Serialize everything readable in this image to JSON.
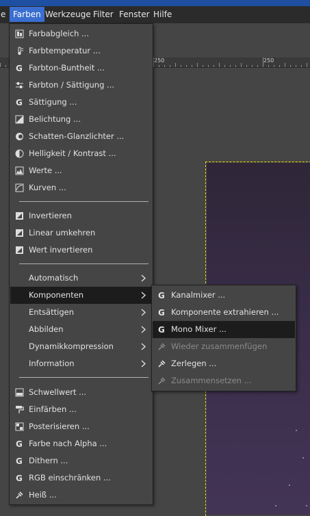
{
  "menubar": {
    "cut_item": "e",
    "items": [
      "Farben",
      "Werkzeuge",
      "Filter",
      "Fenster",
      "Hilfe"
    ]
  },
  "ruler": {
    "labels": [
      "250",
      "250"
    ]
  },
  "farben_menu": {
    "group1": [
      {
        "label": "Farbabgleich ...",
        "icon": "balance-icon"
      },
      {
        "label": "Farbtemperatur ...",
        "icon": "thermometer-icon"
      },
      {
        "label": "Farbton-Buntheit ...",
        "icon": "gegl-icon"
      },
      {
        "label": "Farbton / Sättigung ...",
        "icon": "hue-saturation-icon"
      },
      {
        "label": "Sättigung ...",
        "icon": "gegl-icon"
      },
      {
        "label": "Belichtung ...",
        "icon": "exposure-icon"
      },
      {
        "label": "Schatten-Glanzlichter ...",
        "icon": "shadows-highlights-icon"
      },
      {
        "label": "Helligkeit / Kontrast ...",
        "icon": "contrast-icon"
      },
      {
        "label": "Werte ...",
        "icon": "levels-icon"
      },
      {
        "label": "Kurven ...",
        "icon": "curves-icon"
      }
    ],
    "group2": [
      {
        "label": "Invertieren",
        "icon": "invert-icon"
      },
      {
        "label": "Linear umkehren",
        "icon": "invert-icon"
      },
      {
        "label": "Wert invertieren",
        "icon": "invert-icon"
      }
    ],
    "group3": [
      {
        "label": "Automatisch"
      },
      {
        "label": "Komponenten"
      },
      {
        "label": "Entsättigen"
      },
      {
        "label": "Abbilden"
      },
      {
        "label": "Dynamikkompression"
      },
      {
        "label": "Information"
      }
    ],
    "group4": [
      {
        "label": "Schwellwert ...",
        "icon": "threshold-icon"
      },
      {
        "label": "Einfärben ...",
        "icon": "paint-roller-icon"
      },
      {
        "label": "Posterisieren ...",
        "icon": "posterize-icon"
      },
      {
        "label": "Farbe nach Alpha ...",
        "icon": "gegl-icon"
      },
      {
        "label": "Dithern ...",
        "icon": "gegl-icon"
      },
      {
        "label": "RGB einschränken ...",
        "icon": "gegl-icon"
      },
      {
        "label": "Heiß ...",
        "icon": "plugin-icon"
      }
    ]
  },
  "komponenten_menu": {
    "items": [
      {
        "label": "Kanalmixer ...",
        "icon": "gegl-icon",
        "disabled": false
      },
      {
        "label": "Komponente extrahieren ...",
        "icon": "gegl-icon",
        "disabled": false
      },
      {
        "label": "Mono Mixer ...",
        "icon": "gegl-icon",
        "disabled": false
      },
      {
        "label": "Wieder zusammenfügen",
        "icon": "plugin-icon",
        "disabled": true
      },
      {
        "label": "Zerlegen ...",
        "icon": "plugin-icon",
        "disabled": false
      },
      {
        "label": "Zusammensetzen ...",
        "icon": "plugin-icon",
        "disabled": true
      }
    ]
  },
  "colors": {
    "accent": "#3a6ed0",
    "selection_border": "#e5d800",
    "highlight": "#1c1c1c"
  }
}
